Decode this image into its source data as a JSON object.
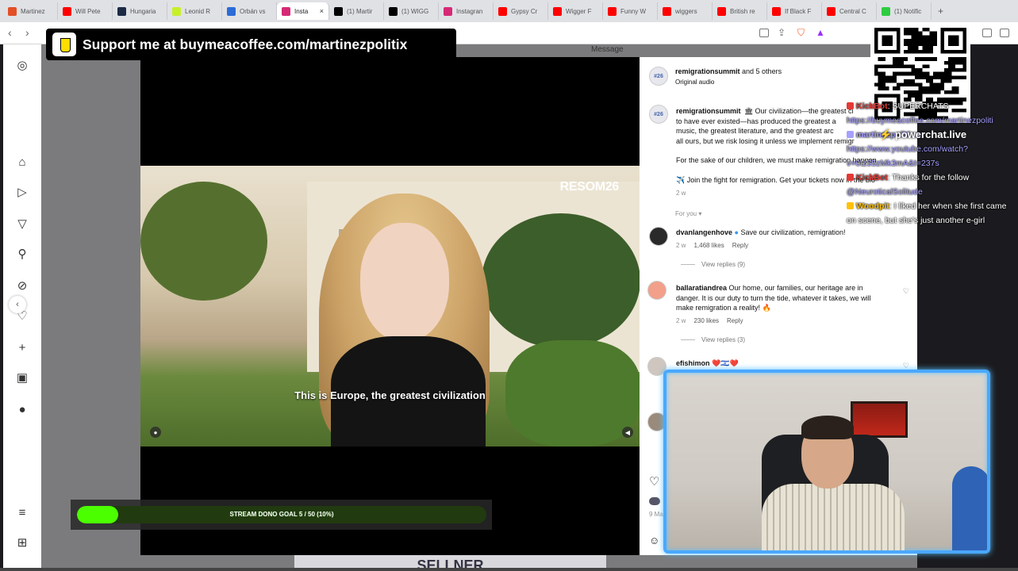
{
  "browser": {
    "tabs": [
      {
        "label": "Martinez",
        "color": "#e34f26"
      },
      {
        "label": "Will Pete",
        "color": "#ff0000"
      },
      {
        "label": "Hungaria",
        "color": "#1c2a44"
      },
      {
        "label": "Leonid R",
        "color": "#c8ef2a"
      },
      {
        "label": "Orbán vs",
        "color": "#2b6cd6"
      },
      {
        "label": "Insta",
        "color": "#d62976",
        "active": true
      },
      {
        "label": "(1) Martir",
        "color": "#000000"
      },
      {
        "label": "(1) WIGG",
        "color": "#000000"
      },
      {
        "label": "Instagran",
        "color": "#d62976"
      },
      {
        "label": "Gypsy Cr",
        "color": "#ff0000"
      },
      {
        "label": "Wigger F",
        "color": "#ff0000"
      },
      {
        "label": "Funny W",
        "color": "#ff0000"
      },
      {
        "label": "wiggers",
        "color": "#ff0000"
      },
      {
        "label": "British re",
        "color": "#ff0000"
      },
      {
        "label": "If Black F",
        "color": "#ff0000"
      },
      {
        "label": "Central C",
        "color": "#ff0000"
      },
      {
        "label": "(1) Notific",
        "color": "#2ecc40"
      }
    ],
    "new_tab": "+",
    "tab_close": "×"
  },
  "page": {
    "message_label": "Message"
  },
  "video": {
    "brand": "RESOM26",
    "subtitle": "This is Europe, the greatest civilization"
  },
  "post": {
    "header_user": "remigrationsummit",
    "header_others": "and 5 others",
    "audio": "Original audio",
    "caption_user": "remigrationsummit",
    "caption_line1": "Our civilization—the greatest ci",
    "caption_line2": "to have ever existed—has produced the greatest a",
    "caption_line3": "music, the greatest literature, and the greatest arc",
    "caption_line4": "all ours, but we risk losing it unless we implement remigr",
    "caption_line5": "For the sake of our children, we must make remigration happen",
    "caption_line6": "Join the fight for remigration. Get your tickets now in the bio",
    "caption_time": "2 w",
    "for_you": "For you"
  },
  "comments": [
    {
      "user": "dvanlangenhove",
      "text": "Save our civilization, remigration!",
      "time": "2 w",
      "likes": "1,468 likes",
      "reply": "Reply",
      "view_replies": "View replies (9)"
    },
    {
      "user": "ballaratiandrea",
      "text_line1": "Our home, our families, our heritage are in",
      "text_line2": "danger. It is our duty to turn the tide, whatever it takes, we will",
      "text_line3": "make remigration a reality!",
      "time": "2 w",
      "likes": "230 likes",
      "reply": "Reply",
      "view_replies": "View replies (3)"
    },
    {
      "user": "efishimon",
      "text": "❤️🇮🇱❤️"
    }
  ],
  "panel_footer": {
    "date": "9 Ma"
  },
  "overlay": {
    "donate": "Support me at buymeacoffee.com/martinezpolitix",
    "powerchat": "powerchat.live",
    "goal_text": "STREAM DONO GOAL 5 / 50 (10%)",
    "goal_progress": 0.1,
    "peek_text": "SELLNER"
  },
  "chat": [
    {
      "user": "KickBot",
      "text": ": SUPERCHATS",
      "color": "#e53935"
    },
    {
      "user": "",
      "text": "https://buymeacoffee.com/martinezpoliti",
      "link": true
    },
    {
      "user": "martinezpolitics",
      "text": " :",
      "color": "#a6a0ff"
    },
    {
      "user": "",
      "text": "https://www.youtube.com/watch?v=0tz55zMk3mA&t=237s",
      "link": true
    },
    {
      "user": "KickBot",
      "text": ": Thanks for the follow",
      "color": "#e53935"
    },
    {
      "user": "",
      "text": "@NeuroticalSolitude",
      "link": true
    },
    {
      "user": "Woodpit",
      "text": ": I liked her when she first came on scene, but she's just another e-girl",
      "color": "#ffc107"
    }
  ],
  "colors": {
    "goal_fill": "#4cff00",
    "webcam_border": "#4aa8ff",
    "instagram_bg": "#ffffff"
  }
}
